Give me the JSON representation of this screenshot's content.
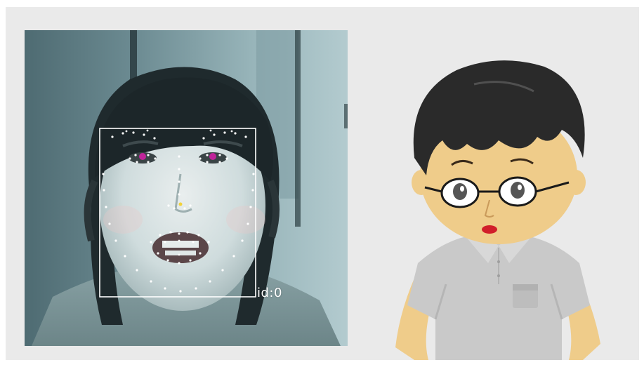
{
  "tracker": {
    "face_id_label": "id:0"
  },
  "avatar": {
    "name": "cartoon-boy-with-glasses"
  },
  "colors": {
    "stage_bg": "#eaeaea",
    "landmark": "#ffffff",
    "pupil_marker": "#c0249a",
    "nose_marker": "#f2d23a",
    "avatar_skin": "#efcc8a",
    "avatar_hair": "#2a2a2a",
    "avatar_shirt": "#c9c9c9"
  },
  "icons": {
    "pupil_marker": "pupil-marker-icon",
    "nose_marker": "nose-marker-icon"
  }
}
